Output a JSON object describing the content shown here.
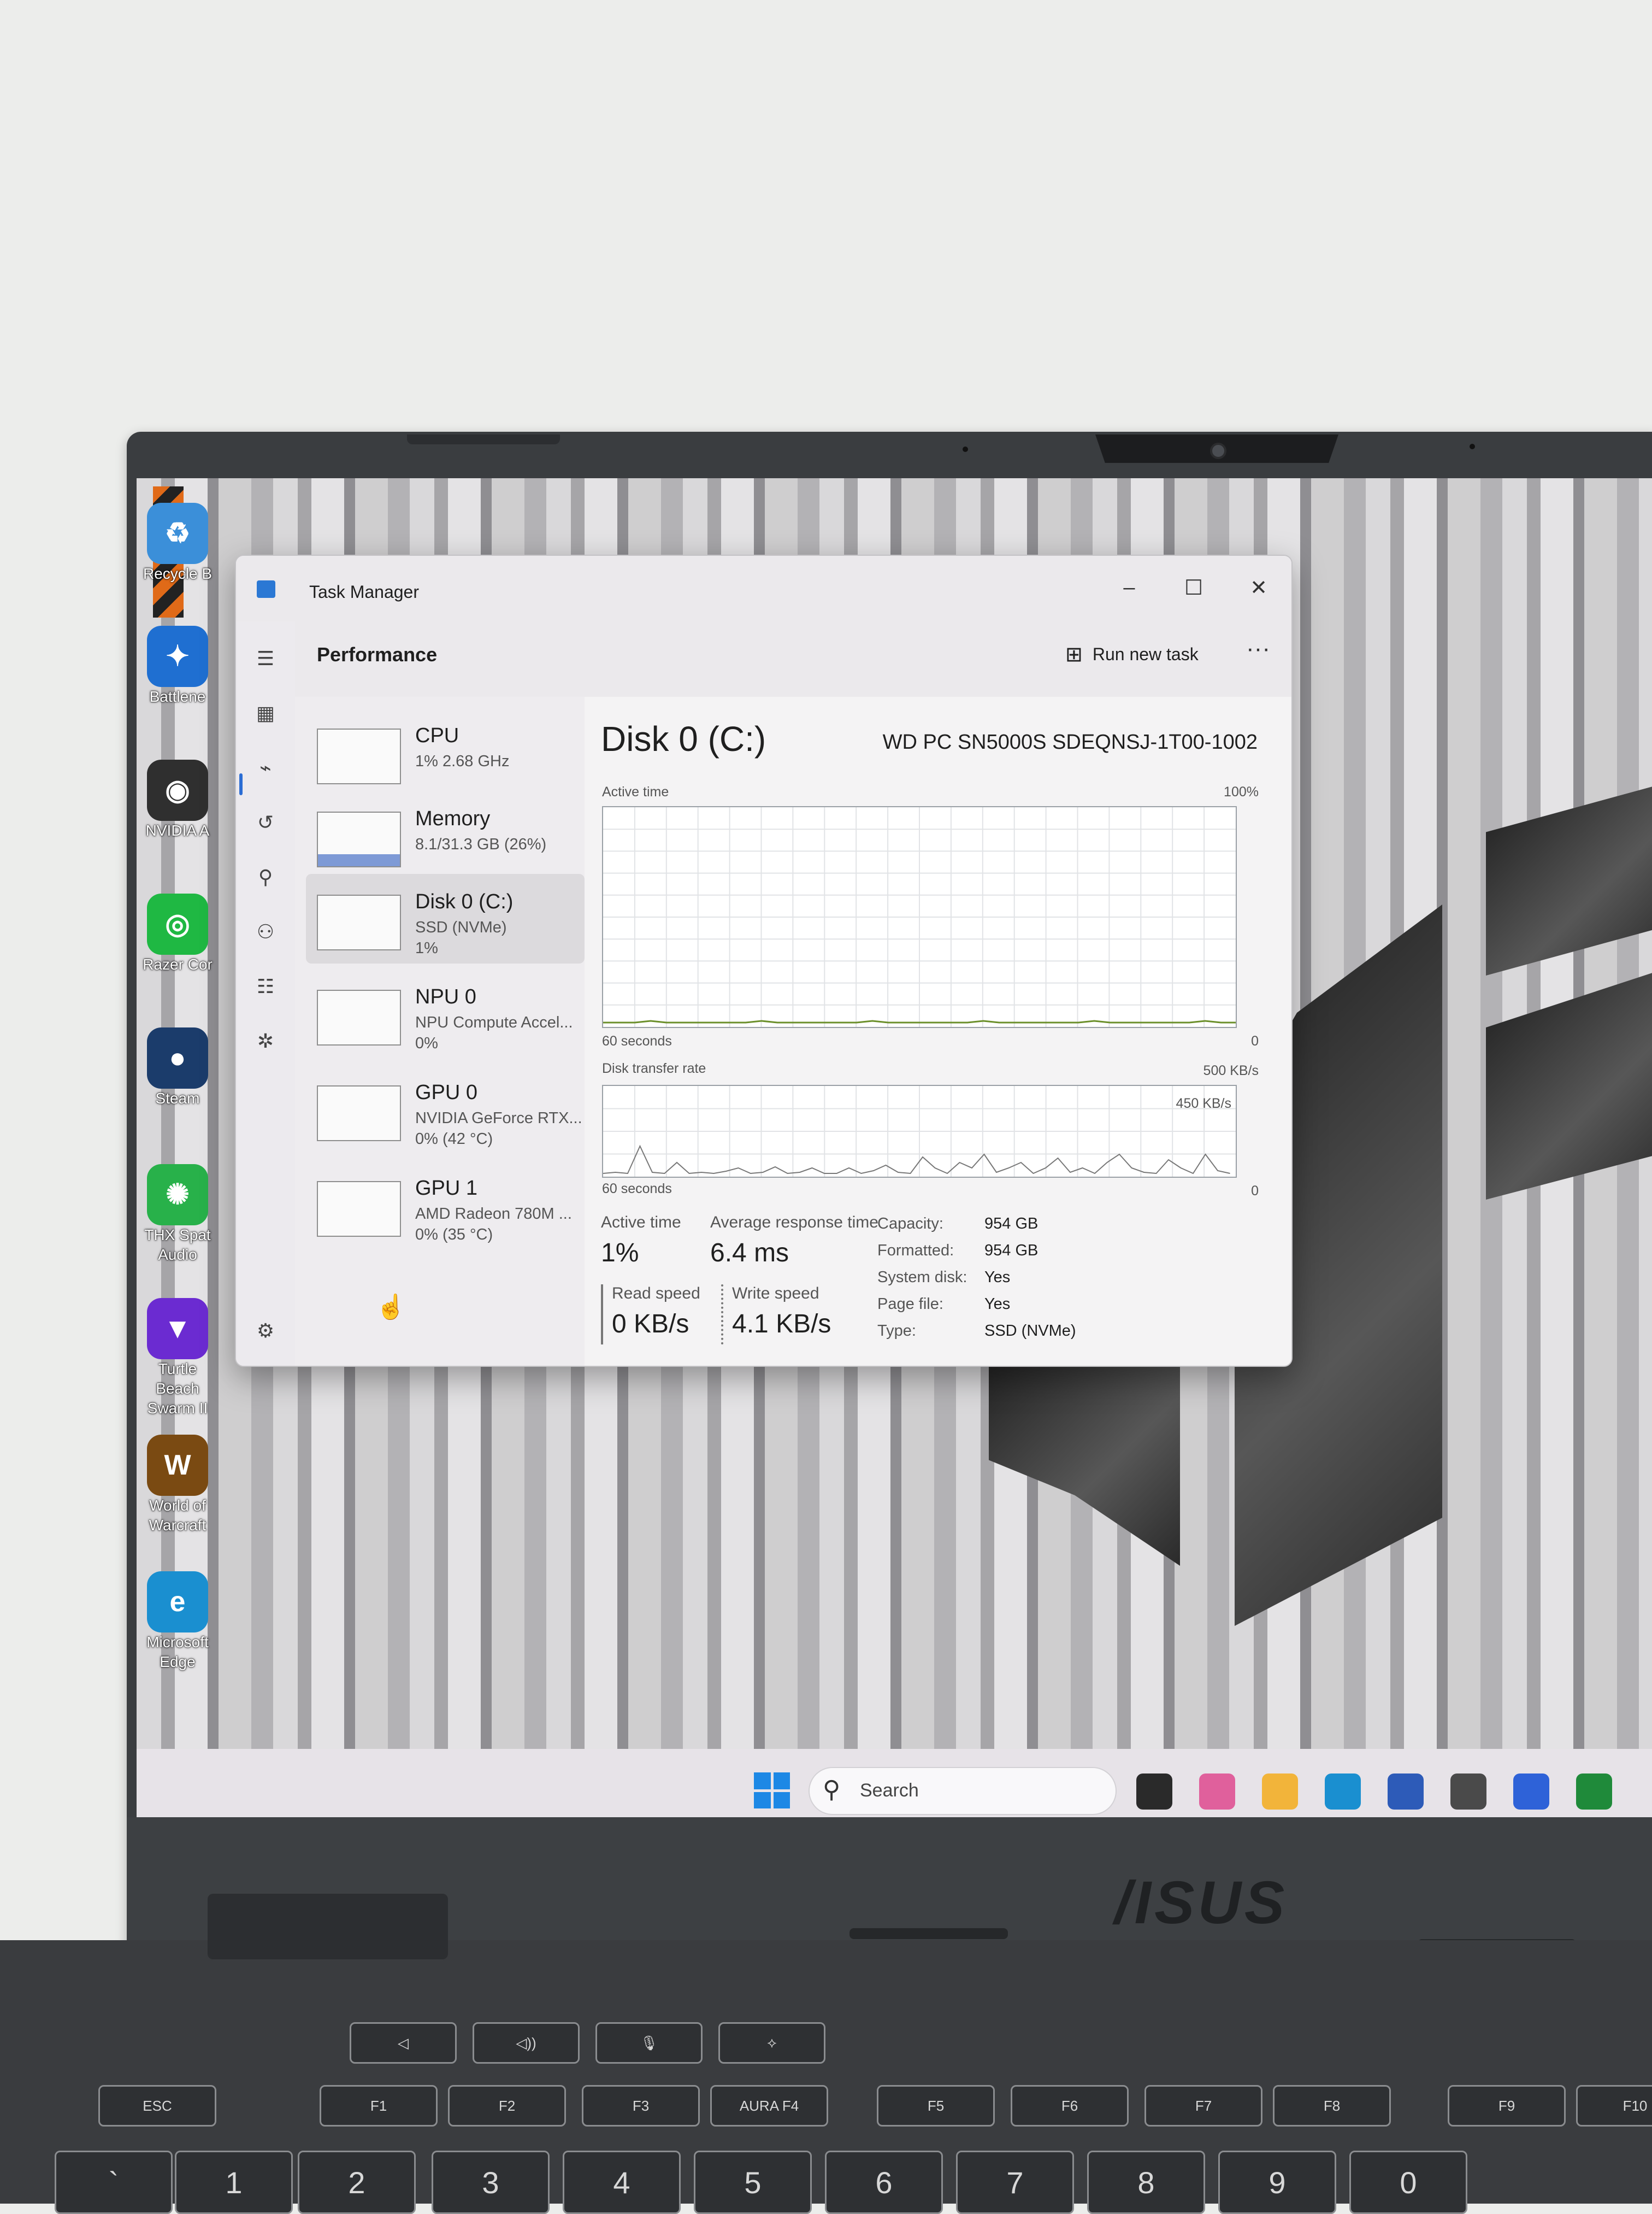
{
  "window": {
    "title": "Task Manager",
    "controls": {
      "minimize": "–",
      "maximize": "☐",
      "close": "✕"
    }
  },
  "header": {
    "page_title": "Performance",
    "run_new_task": "Run new task",
    "more": "···"
  },
  "resources": [
    {
      "name": "CPU",
      "line1": "1%  2.68 GHz",
      "line2": ""
    },
    {
      "name": "Memory",
      "line1": "8.1/31.3 GB (26%)",
      "line2": ""
    },
    {
      "name": "Disk 0 (C:)",
      "line1": "SSD (NVMe)",
      "line2": "1%"
    },
    {
      "name": "NPU 0",
      "line1": "NPU Compute Accel...",
      "line2": "0%"
    },
    {
      "name": "GPU 0",
      "line1": "NVIDIA GeForce RTX...",
      "line2": "0%  (42 °C)"
    },
    {
      "name": "GPU 1",
      "line1": "AMD Radeon 780M ...",
      "line2": "0%  (35 °C)"
    }
  ],
  "detail": {
    "title": "Disk 0 (C:)",
    "model": "WD PC SN5000S SDEQNSJ-1T00-1002",
    "graph1": {
      "label": "Active time",
      "max": "100%",
      "x_label": "60 seconds",
      "x_end": "0"
    },
    "graph2": {
      "label": "Disk transfer rate",
      "max": "500 KB/s",
      "inner_label": "450 KB/s",
      "x_label": "60 seconds",
      "x_end": "0"
    },
    "stats": {
      "active_time_label": "Active time",
      "active_time": "1%",
      "avg_resp_label": "Average response time",
      "avg_resp": "6.4 ms",
      "read_label": "Read speed",
      "read": "0 KB/s",
      "write_label": "Write speed",
      "write": "4.1 KB/s"
    },
    "properties": [
      {
        "label": "Capacity:",
        "value": "954 GB"
      },
      {
        "label": "Formatted:",
        "value": "954 GB"
      },
      {
        "label": "System disk:",
        "value": "Yes"
      },
      {
        "label": "Page file:",
        "value": "Yes"
      },
      {
        "label": "Type:",
        "value": "SSD (NVMe)"
      }
    ]
  },
  "desktop_icons": [
    {
      "label": "Recycle B",
      "glyph": "♻",
      "color": "#3b8fd9"
    },
    {
      "label": "Battlene",
      "glyph": "✦",
      "color": "#1f6fd1"
    },
    {
      "label": "NVIDIA A",
      "glyph": "◉",
      "color": "#2f2f2f"
    },
    {
      "label": "Razer Cor",
      "glyph": "◎",
      "color": "#1fb843"
    },
    {
      "label": "Steam",
      "glyph": "●",
      "color": "#1b3c6b"
    },
    {
      "label": "THX Spat Audio",
      "glyph": "✺",
      "color": "#28b14a"
    },
    {
      "label": "Turtle Beach Swarm II",
      "glyph": "▼",
      "color": "#6b2bd1"
    },
    {
      "label": "World of Warcraft",
      "glyph": "W",
      "color": "#7a4a12"
    },
    {
      "label": "Microsoft Edge",
      "glyph": "e",
      "color": "#1a8fd0"
    }
  ],
  "taskbar": {
    "search_placeholder": "Search",
    "apps": [
      {
        "name": "task-view-icon",
        "color": "#2a2a2a"
      },
      {
        "name": "copilot-icon",
        "color": "#e0609c"
      },
      {
        "name": "file-explorer-icon",
        "color": "#f2b43a"
      },
      {
        "name": "edge-icon",
        "color": "#1a8fd0"
      },
      {
        "name": "store-icon",
        "color": "#2d5bb8"
      },
      {
        "name": "armoury-icon",
        "color": "#4a4a4a"
      },
      {
        "name": "myasus-icon",
        "color": "#2e62d8"
      },
      {
        "name": "xbox-icon",
        "color": "#1f8a3a"
      }
    ]
  },
  "brand": "/ISUS",
  "keyboard": {
    "top_row": [
      "◁",
      "◁))",
      "🎙",
      "⟡"
    ],
    "fn_row": [
      "ESC",
      "F1",
      "F2",
      "F3",
      "AURA F4",
      "F5",
      "F6",
      "F7",
      "F8",
      "F9",
      "F10"
    ],
    "num_row": [
      "`",
      "1",
      "2",
      "3",
      "4",
      "5",
      "6",
      "7",
      "8",
      "9",
      "0"
    ]
  },
  "colors": {
    "accent": "#2b6dd4",
    "memory_fill": "#7e9ad6",
    "graph_line": "#6b8f2a"
  }
}
